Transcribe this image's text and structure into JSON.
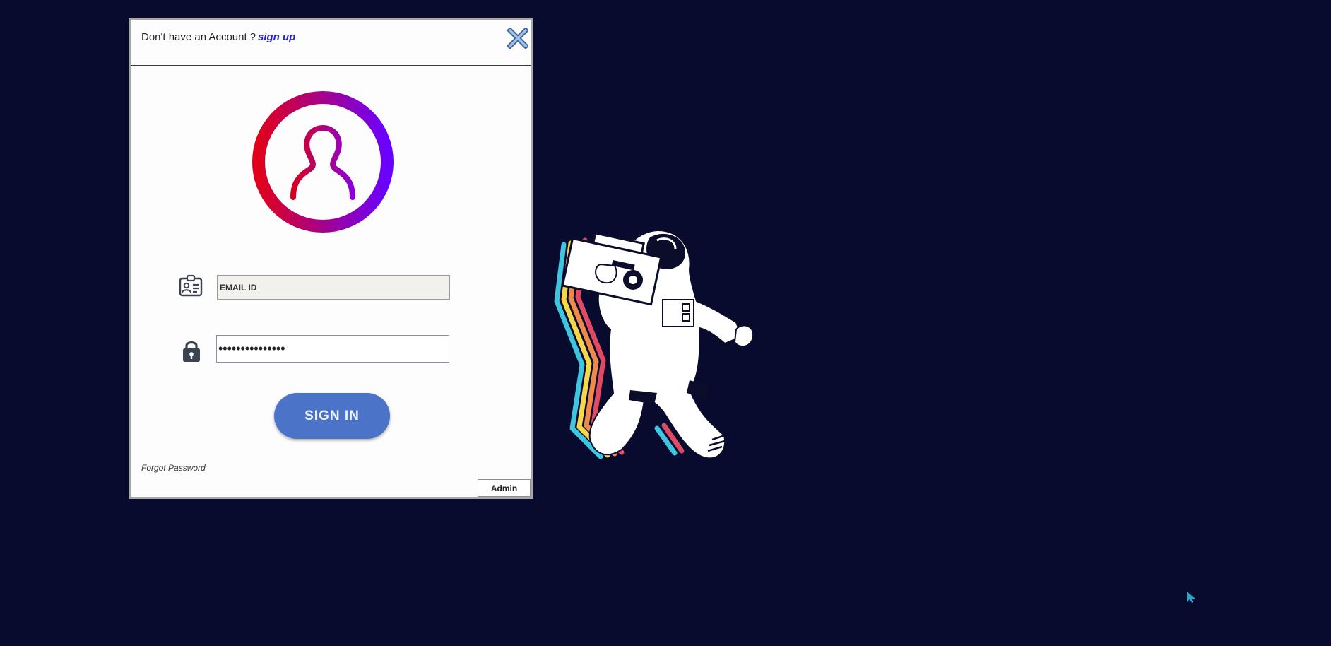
{
  "header": {
    "prompt": "Don't have an Account ?",
    "signup_label": "sign up",
    "close_icon": "close-x-icon"
  },
  "avatar": {
    "icon": "user-circle-icon",
    "gradient": [
      "#e0001b",
      "#6a00ff"
    ]
  },
  "email": {
    "icon": "id-card-icon",
    "value": "EMAIL ID",
    "placeholder": "EMAIL ID"
  },
  "password": {
    "icon": "lock-icon",
    "masked_value": "•••••••••••••••"
  },
  "signin_label": "SIGN IN",
  "forgot_label": "Forgot Password",
  "admin_label": "Admin",
  "colors": {
    "background": "#080a2e",
    "signin_button": "#4b74c8",
    "signup_link": "#2121d6"
  }
}
